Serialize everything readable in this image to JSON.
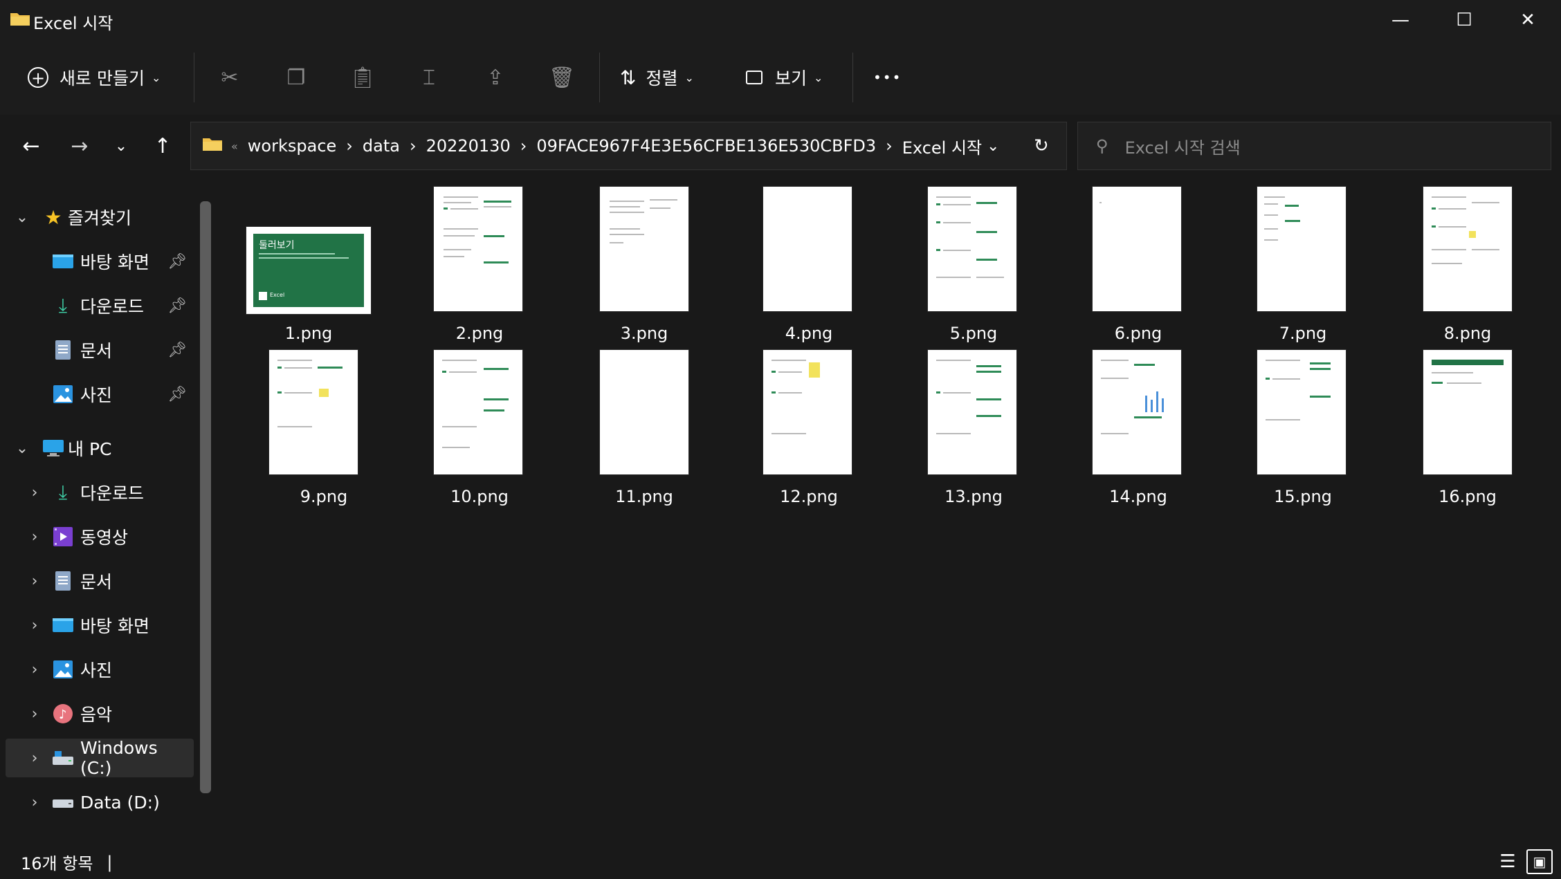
{
  "window": {
    "title": "Excel 시작",
    "minimize": "—",
    "maximize": "☐",
    "close": "✕"
  },
  "toolbar": {
    "new_label": "새로 만들기",
    "sort_label": "정렬",
    "view_label": "보기",
    "more_label": "•••"
  },
  "address": {
    "overflow": "«",
    "segments": [
      "workspace",
      "data",
      "20220130",
      "09FACE967F4E3E56CFBE136E530CBFD3",
      "Excel 시작"
    ]
  },
  "search": {
    "placeholder": "Excel 시작 검색"
  },
  "sidebar": {
    "quick_access_label": "즐겨찾기",
    "quick_items": [
      "바탕 화면",
      "다운로드",
      "문서",
      "사진"
    ],
    "pc_label": "내 PC",
    "pc_items": [
      "다운로드",
      "동영상",
      "문서",
      "바탕 화면",
      "사진",
      "음악",
      "Windows (C:)",
      "Data (D:)"
    ]
  },
  "files": [
    "1.png",
    "2.png",
    "3.png",
    "4.png",
    "5.png",
    "6.png",
    "7.png",
    "8.png",
    "9.png",
    "10.png",
    "11.png",
    "12.png",
    "13.png",
    "14.png",
    "15.png",
    "16.png"
  ],
  "thumbnail_1": {
    "title": "둘러보기",
    "brand": "Excel"
  },
  "status": {
    "count": "16개 항목",
    "cursor": "|"
  },
  "colors": {
    "accent_green": "#217346",
    "folder_yellow": "#f0c04a",
    "background": "#191919"
  }
}
